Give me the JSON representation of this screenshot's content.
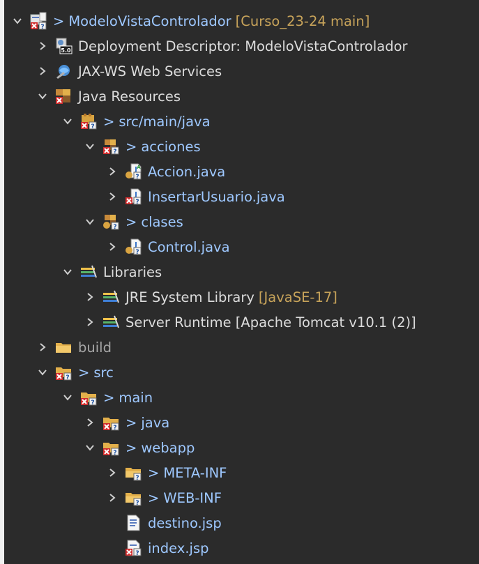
{
  "tree": {
    "project": {
      "prefix": ">",
      "label": "ModeloVistaControlador",
      "decorator": "[Curso_23-24 main]",
      "icon": "web-project-icon"
    },
    "deployment_descriptor": {
      "label": "Deployment Descriptor: ModeloVistaControlador",
      "badge": "5.0",
      "icon": "deployment-descriptor-icon"
    },
    "jaxws": {
      "label": "JAX-WS Web Services",
      "icon": "jaxws-icon"
    },
    "java_resources": {
      "label": "Java Resources",
      "icon": "java-resources-icon"
    },
    "src_main_java": {
      "prefix": ">",
      "label": "src/main/java",
      "icon": "source-folder-icon"
    },
    "pkg_acciones": {
      "prefix": ">",
      "label": "acciones",
      "icon": "package-icon"
    },
    "accion_java": {
      "label": "Accion.java",
      "icon": "java-file-icon"
    },
    "insertar_usuario_java": {
      "label": "InsertarUsuario.java",
      "icon": "java-file-error-icon"
    },
    "pkg_clases": {
      "prefix": ">",
      "label": "clases",
      "icon": "package-icon"
    },
    "control_java": {
      "label": "Control.java",
      "icon": "java-file-icon"
    },
    "libraries": {
      "label": "Libraries",
      "icon": "libraries-icon"
    },
    "jre_system_library": {
      "label": "JRE System Library",
      "decorator": "[JavaSE-17]",
      "icon": "library-icon"
    },
    "server_runtime": {
      "label": "Server Runtime [Apache Tomcat v10.1 (2)]",
      "icon": "library-icon"
    },
    "build": {
      "label": "build",
      "icon": "folder-icon"
    },
    "src": {
      "prefix": ">",
      "label": "src",
      "icon": "folder-error-icon"
    },
    "main": {
      "prefix": ">",
      "label": "main",
      "icon": "folder-error-icon"
    },
    "java": {
      "prefix": ">",
      "label": "java",
      "icon": "folder-error-icon"
    },
    "webapp": {
      "prefix": ">",
      "label": "webapp",
      "icon": "folder-error-icon"
    },
    "meta_inf": {
      "prefix": ">",
      "label": "META-INF",
      "icon": "folder-icon"
    },
    "web_inf": {
      "prefix": ">",
      "label": "WEB-INF",
      "icon": "folder-icon"
    },
    "destino_jsp": {
      "label": "destino.jsp",
      "icon": "jsp-file-icon"
    },
    "index_jsp": {
      "label": "index.jsp",
      "icon": "jsp-file-error-icon"
    }
  },
  "colors": {
    "background": "#2b2b2b",
    "text": "#dcdcdc",
    "link_blue": "#9ec8ff",
    "decorator": "#c7a35a",
    "chevron": "#cfcfcf",
    "error_red": "#d12e2e"
  }
}
